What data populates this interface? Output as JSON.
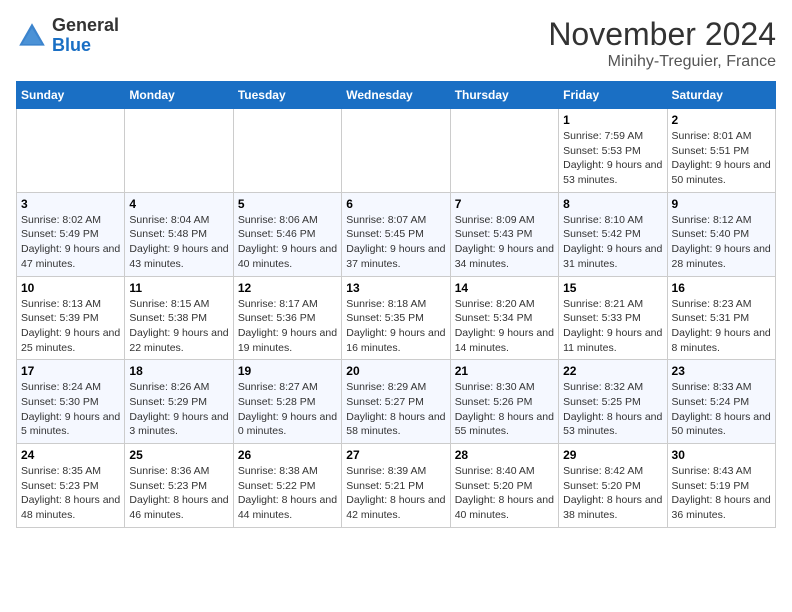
{
  "header": {
    "logo_general": "General",
    "logo_blue": "Blue",
    "month_title": "November 2024",
    "subtitle": "Minihy-Treguier, France"
  },
  "weekdays": [
    "Sunday",
    "Monday",
    "Tuesday",
    "Wednesday",
    "Thursday",
    "Friday",
    "Saturday"
  ],
  "weeks": [
    [
      {
        "day": "",
        "info": ""
      },
      {
        "day": "",
        "info": ""
      },
      {
        "day": "",
        "info": ""
      },
      {
        "day": "",
        "info": ""
      },
      {
        "day": "",
        "info": ""
      },
      {
        "day": "1",
        "info": "Sunrise: 7:59 AM\nSunset: 5:53 PM\nDaylight: 9 hours and 53 minutes."
      },
      {
        "day": "2",
        "info": "Sunrise: 8:01 AM\nSunset: 5:51 PM\nDaylight: 9 hours and 50 minutes."
      }
    ],
    [
      {
        "day": "3",
        "info": "Sunrise: 8:02 AM\nSunset: 5:49 PM\nDaylight: 9 hours and 47 minutes."
      },
      {
        "day": "4",
        "info": "Sunrise: 8:04 AM\nSunset: 5:48 PM\nDaylight: 9 hours and 43 minutes."
      },
      {
        "day": "5",
        "info": "Sunrise: 8:06 AM\nSunset: 5:46 PM\nDaylight: 9 hours and 40 minutes."
      },
      {
        "day": "6",
        "info": "Sunrise: 8:07 AM\nSunset: 5:45 PM\nDaylight: 9 hours and 37 minutes."
      },
      {
        "day": "7",
        "info": "Sunrise: 8:09 AM\nSunset: 5:43 PM\nDaylight: 9 hours and 34 minutes."
      },
      {
        "day": "8",
        "info": "Sunrise: 8:10 AM\nSunset: 5:42 PM\nDaylight: 9 hours and 31 minutes."
      },
      {
        "day": "9",
        "info": "Sunrise: 8:12 AM\nSunset: 5:40 PM\nDaylight: 9 hours and 28 minutes."
      }
    ],
    [
      {
        "day": "10",
        "info": "Sunrise: 8:13 AM\nSunset: 5:39 PM\nDaylight: 9 hours and 25 minutes."
      },
      {
        "day": "11",
        "info": "Sunrise: 8:15 AM\nSunset: 5:38 PM\nDaylight: 9 hours and 22 minutes."
      },
      {
        "day": "12",
        "info": "Sunrise: 8:17 AM\nSunset: 5:36 PM\nDaylight: 9 hours and 19 minutes."
      },
      {
        "day": "13",
        "info": "Sunrise: 8:18 AM\nSunset: 5:35 PM\nDaylight: 9 hours and 16 minutes."
      },
      {
        "day": "14",
        "info": "Sunrise: 8:20 AM\nSunset: 5:34 PM\nDaylight: 9 hours and 14 minutes."
      },
      {
        "day": "15",
        "info": "Sunrise: 8:21 AM\nSunset: 5:33 PM\nDaylight: 9 hours and 11 minutes."
      },
      {
        "day": "16",
        "info": "Sunrise: 8:23 AM\nSunset: 5:31 PM\nDaylight: 9 hours and 8 minutes."
      }
    ],
    [
      {
        "day": "17",
        "info": "Sunrise: 8:24 AM\nSunset: 5:30 PM\nDaylight: 9 hours and 5 minutes."
      },
      {
        "day": "18",
        "info": "Sunrise: 8:26 AM\nSunset: 5:29 PM\nDaylight: 9 hours and 3 minutes."
      },
      {
        "day": "19",
        "info": "Sunrise: 8:27 AM\nSunset: 5:28 PM\nDaylight: 9 hours and 0 minutes."
      },
      {
        "day": "20",
        "info": "Sunrise: 8:29 AM\nSunset: 5:27 PM\nDaylight: 8 hours and 58 minutes."
      },
      {
        "day": "21",
        "info": "Sunrise: 8:30 AM\nSunset: 5:26 PM\nDaylight: 8 hours and 55 minutes."
      },
      {
        "day": "22",
        "info": "Sunrise: 8:32 AM\nSunset: 5:25 PM\nDaylight: 8 hours and 53 minutes."
      },
      {
        "day": "23",
        "info": "Sunrise: 8:33 AM\nSunset: 5:24 PM\nDaylight: 8 hours and 50 minutes."
      }
    ],
    [
      {
        "day": "24",
        "info": "Sunrise: 8:35 AM\nSunset: 5:23 PM\nDaylight: 8 hours and 48 minutes."
      },
      {
        "day": "25",
        "info": "Sunrise: 8:36 AM\nSunset: 5:23 PM\nDaylight: 8 hours and 46 minutes."
      },
      {
        "day": "26",
        "info": "Sunrise: 8:38 AM\nSunset: 5:22 PM\nDaylight: 8 hours and 44 minutes."
      },
      {
        "day": "27",
        "info": "Sunrise: 8:39 AM\nSunset: 5:21 PM\nDaylight: 8 hours and 42 minutes."
      },
      {
        "day": "28",
        "info": "Sunrise: 8:40 AM\nSunset: 5:20 PM\nDaylight: 8 hours and 40 minutes."
      },
      {
        "day": "29",
        "info": "Sunrise: 8:42 AM\nSunset: 5:20 PM\nDaylight: 8 hours and 38 minutes."
      },
      {
        "day": "30",
        "info": "Sunrise: 8:43 AM\nSunset: 5:19 PM\nDaylight: 8 hours and 36 minutes."
      }
    ]
  ]
}
